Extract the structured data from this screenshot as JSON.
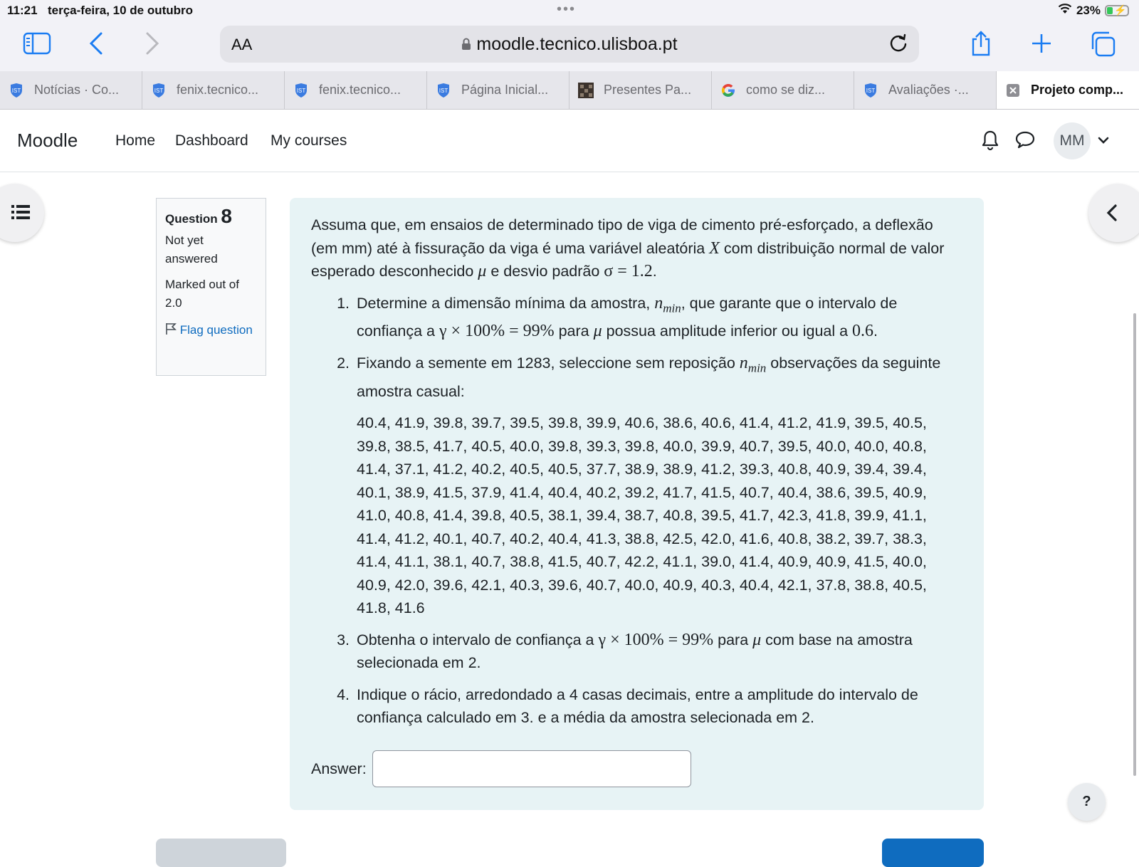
{
  "status_bar": {
    "time": "11:21",
    "date": "terça-feira, 10 de outubro",
    "dots": "•••",
    "battery": "23%"
  },
  "browser": {
    "text_size_label": "AA",
    "url": "moodle.tecnico.ulisboa.pt",
    "accent_color": "#1a7cf2",
    "tabs": [
      {
        "title": "Notícias · Co...",
        "icon": "tecnico-shield-icon"
      },
      {
        "title": "fenix.tecnico...",
        "icon": "tecnico-shield-icon"
      },
      {
        "title": "fenix.tecnico...",
        "icon": "tecnico-shield-icon"
      },
      {
        "title": "Página Inicial...",
        "icon": "tecnico-shield-icon"
      },
      {
        "title": "Presentes Pa...",
        "icon": "grid-favicon-icon"
      },
      {
        "title": "como se diz...",
        "icon": "google-icon"
      },
      {
        "title": "Avaliações ·...",
        "icon": "tecnico-shield-icon"
      },
      {
        "title": "Projeto comp...",
        "icon": "close-tab-icon",
        "active": true
      }
    ]
  },
  "moodle_nav": {
    "brand": "Moodle",
    "links": [
      "Home",
      "Dashboard",
      "My courses"
    ],
    "avatar_initials": "MM"
  },
  "question_info": {
    "label": "Question",
    "number": "8",
    "state": "Not yet answered",
    "marked": "Marked out of 2.0",
    "flag": "Flag question"
  },
  "question": {
    "intro_parts": [
      "Assuma que, em ensaios de determinado tipo de viga de cimento pré-esforçado, a deflexão (em mm) até à fissuração da viga é uma variável aleatória ",
      "X",
      " com distribuição normal de valor esperado desconhecido ",
      "μ",
      " e desvio padrão ",
      "σ = 1.2",
      "."
    ],
    "item1": {
      "t1": "Determine a dimensão mínima da amostra, ",
      "n": "n",
      "sub": "min",
      "t2": ", que garante que o intervalo de confiança a ",
      "expr": "γ × 100% = 99%",
      "t3": " para ",
      "mu": "μ",
      "t4": " possua amplitude inferior ou igual a ",
      "val": "0.6",
      "t5": "."
    },
    "item2": {
      "t1": "Fixando a semente em 1283, seleccione sem reposição ",
      "n": "n",
      "sub": "min",
      "t2": " observações da seguinte amostra casual:",
      "data_lines": [
        "40.4, 41.9, 39.8, 39.7, 39.5, 39.8, 39.9, 40.6, 38.6, 40.6, 41.4, 41.2, 41.9, 39.5, 40.5,",
        "39.8, 38.5, 41.7, 40.5, 40.0, 39.8, 39.3, 39.8, 40.0, 39.9, 40.7, 39.5, 40.0, 40.0, 40.8,",
        "41.4, 37.1, 41.2, 40.2, 40.5, 40.5, 37.7, 38.9, 38.9, 41.2, 39.3, 40.8, 40.9, 39.4, 39.4,",
        "40.1, 38.9, 41.5, 37.9, 41.4, 40.4, 40.2, 39.2, 41.7, 41.5, 40.7, 40.4, 38.6, 39.5, 40.9,",
        "41.0, 40.8, 41.4, 39.8, 40.5, 38.1, 39.4, 38.7, 40.8, 39.5, 41.7, 42.3, 41.8, 39.9, 41.1,",
        "41.4, 41.2, 40.1, 40.7, 40.2, 40.4, 41.3, 38.8, 42.5, 42.0, 41.6, 40.8, 38.2, 39.7, 38.3,",
        "41.4, 41.1, 38.1, 40.7, 38.8, 41.5, 40.7, 42.2, 41.1, 39.0, 41.4, 40.9, 40.9, 41.5, 40.0,",
        "40.9, 42.0, 39.6, 42.1, 40.3, 39.6, 40.7, 40.0, 40.9, 40.3, 40.4, 42.1, 37.8, 38.8, 40.5,",
        "41.8, 41.6"
      ]
    },
    "item3": {
      "t1": "Obtenha o intervalo de confiança a ",
      "expr": "γ × 100% = 99%",
      "t2": " para ",
      "mu": "μ",
      "t3": " com base na amostra selecionada em 2."
    },
    "item4": {
      "text": "Indique o rácio, arredondado a 4 casas decimais, entre a amplitude do intervalo de confiança calculado em 3. e a média da amostra selecionada em 2."
    },
    "answer_label": "Answer:",
    "answer_value": ""
  },
  "help_label": "?"
}
